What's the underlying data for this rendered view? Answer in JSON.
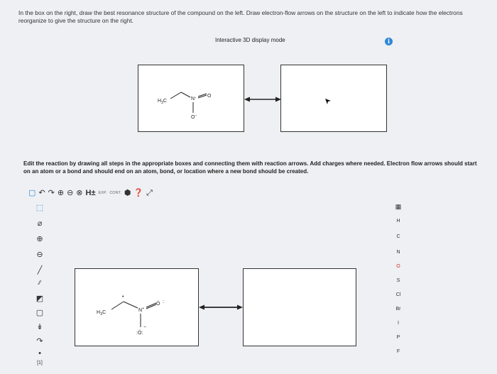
{
  "instructions": "In the box on the right, draw the best resonance structure of the compound on the left. Draw electron-flow arrows on the structure on the left to indicate how the electrons reorganize to give the structure on the right.",
  "display_mode": {
    "label": "Interactive 3D display mode",
    "info_icon": "info-icon",
    "accent": "#2f86d6"
  },
  "preview": {
    "left_molecule": {
      "ch3": "H3C",
      "n": "N",
      "o_top": "O",
      "o_bottom": "O"
    },
    "arrow": "resonance-arrow"
  },
  "edit_instructions": "Edit the reaction by drawing all steps in the appropriate boxes and connecting them with reaction arrows. Add charges where needed. Electron flow arrows should start on an atom or a bond and should end on an atom, bond, or location where a new bond should be created.",
  "toolbar": {
    "items": [
      "new-document-icon",
      "undo-icon",
      "redo-icon",
      "zoom-in-icon",
      "zoom-out-icon",
      "zoom-fit-icon",
      "hydrogen-toggle-icon",
      "expand-icon",
      "contract-icon",
      "info-icon",
      "help-icon",
      "fullscreen-icon"
    ],
    "hydrogen_label": "H±",
    "expand_label": "EXP.",
    "contract_label": "CONT."
  },
  "left_tools": [
    "select-tool",
    "eraser-tool",
    "positive-charge-tool",
    "negative-charge-tool",
    "bond-tool",
    "chain-tool",
    "ring-tool",
    "rectangle-tool",
    "arrow-tool",
    "curved-arrow-tool",
    "lone-pair-tool"
  ],
  "right_tools": {
    "periodic_table_icon": "periodic-table-icon",
    "elements": [
      "H",
      "C",
      "N",
      "O",
      "S",
      "Cl",
      "Br",
      "I",
      "P",
      "F"
    ]
  },
  "bottom_label": "[1]",
  "editor": {
    "left_molecule": {
      "ch3": "H3C",
      "n": "N",
      "o_top": "O",
      "o_bottom": "O"
    },
    "arrow": "resonance-arrow"
  }
}
